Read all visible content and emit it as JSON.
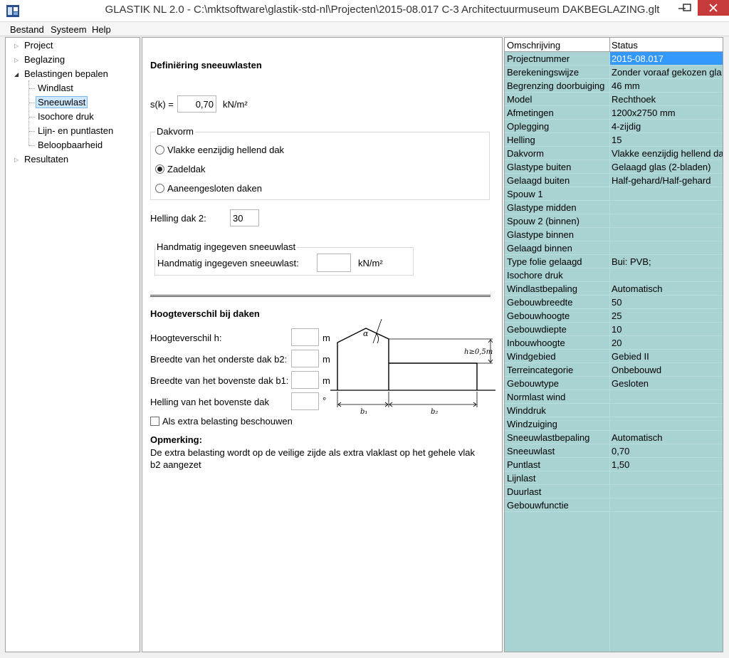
{
  "window": {
    "title": "GLASTIK NL 2.0 - C:\\mktsoftware\\glastik-std-nl\\Projecten\\2015-08.017 C-3 Architectuurmuseum DAKBEGLAZING.glt"
  },
  "menu": {
    "items": [
      {
        "label": "Bestand"
      },
      {
        "label": "Systeem"
      },
      {
        "label": "Help"
      }
    ]
  },
  "tree": {
    "items": [
      {
        "label": "Project"
      },
      {
        "label": "Beglazing"
      },
      {
        "label": "Belastingen bepalen"
      },
      {
        "label": "Windlast"
      },
      {
        "label": "Sneeuwlast"
      },
      {
        "label": "Isochore druk"
      },
      {
        "label": "Lijn- en puntlasten"
      },
      {
        "label": "Beloopbaarheid"
      },
      {
        "label": "Resultaten"
      }
    ]
  },
  "form": {
    "heading": "Definiëring sneeuwlasten",
    "sk_label": "s(k) =",
    "sk_value": "0,70",
    "sk_unit": "kN/m²",
    "dakvorm": {
      "title": "Dakvorm",
      "options": [
        {
          "label": "Vlakke eenzijdig hellend dak"
        },
        {
          "label": "Zadeldak"
        },
        {
          "label": "Aaneengesloten daken"
        }
      ],
      "selected": "Zadeldak"
    },
    "helling_dak2_label": "Helling dak 2:",
    "helling_dak2_value": "30",
    "manual": {
      "title": "Handmatig ingegeven sneeuwlast",
      "label": "Handmatig ingegeven sneeuwlast:",
      "value": "",
      "unit": "kN/m²"
    },
    "height_section": {
      "heading": "Hoogteverschil bij daken",
      "rows": [
        {
          "label": "Hoogteverschil h:",
          "value": "",
          "unit": "m"
        },
        {
          "label": "Breedte van het onderste dak b2:",
          "value": "",
          "unit": "m"
        },
        {
          "label": "Breedte van het bovenste dak b1:",
          "value": "",
          "unit": "m"
        },
        {
          "label": "Helling van het bovenste dak",
          "value": "",
          "unit": "°"
        }
      ],
      "checkbox_label": "Als extra belasting beschouwen",
      "checkbox_checked": false
    },
    "diagram": {
      "alpha": "α",
      "h_label": "h≥0,5m",
      "b1": "b₁",
      "b2": "b₂"
    },
    "note_title": "Opmerking:",
    "note_line1": "De extra belasting wordt op de veilige zijde als extra vlaklast op het gehele vlak",
    "note_line2": "b2 aangezet"
  },
  "grid": {
    "headers": {
      "col1": "Omschrijving",
      "col2": "Status"
    },
    "rows": [
      {
        "name": "Projectnummer",
        "value": "2015-08.017"
      },
      {
        "name": "Berekeningswijze",
        "value": "Zonder voraaf gekozen gla"
      },
      {
        "name": "Begrenzing doorbuiging",
        "value": "46 mm"
      },
      {
        "name": "Model",
        "value": "Rechthoek"
      },
      {
        "name": "Afmetingen",
        "value": "1200x2750 mm"
      },
      {
        "name": "Oplegging",
        "value": "4-zijdig"
      },
      {
        "name": "Helling",
        "value": "15"
      },
      {
        "name": "Dakvorm",
        "value": "Vlakke eenzijdig hellend da"
      },
      {
        "name": "Glastype buiten",
        "value": "Gelaagd glas (2-bladen)"
      },
      {
        "name": "Gelaagd buiten",
        "value": "Half-gehard/Half-gehard"
      },
      {
        "name": "Spouw 1",
        "value": ""
      },
      {
        "name": "Glastype midden",
        "value": ""
      },
      {
        "name": "Spouw 2 (binnen)",
        "value": ""
      },
      {
        "name": "Glastype binnen",
        "value": ""
      },
      {
        "name": "Gelaagd binnen",
        "value": ""
      },
      {
        "name": "Type folie gelaagd",
        "value": "Bui: PVB;"
      },
      {
        "name": "Isochore druk",
        "value": ""
      },
      {
        "name": "Windlastbepaling",
        "value": "Automatisch"
      },
      {
        "name": "Gebouwbreedte",
        "value": "50"
      },
      {
        "name": "Gebouwhoogte",
        "value": "25"
      },
      {
        "name": "Gebouwdiepte",
        "value": "10"
      },
      {
        "name": "Inbouwhoogte",
        "value": "20"
      },
      {
        "name": "Windgebied",
        "value": "Gebied II"
      },
      {
        "name": "Terreincategorie",
        "value": "Onbebouwd"
      },
      {
        "name": "Gebouwtype",
        "value": "Gesloten"
      },
      {
        "name": "Normlast wind",
        "value": ""
      },
      {
        "name": "Winddruk",
        "value": ""
      },
      {
        "name": "Windzuiging",
        "value": ""
      },
      {
        "name": "Sneeuwlastbepaling",
        "value": "Automatisch"
      },
      {
        "name": "Sneeuwlast",
        "value": "0,70"
      },
      {
        "name": "Puntlast",
        "value": "1,50"
      },
      {
        "name": "Lijnlast",
        "value": ""
      },
      {
        "name": "Duurlast",
        "value": ""
      },
      {
        "name": "Gebouwfunctie",
        "value": ""
      }
    ]
  }
}
